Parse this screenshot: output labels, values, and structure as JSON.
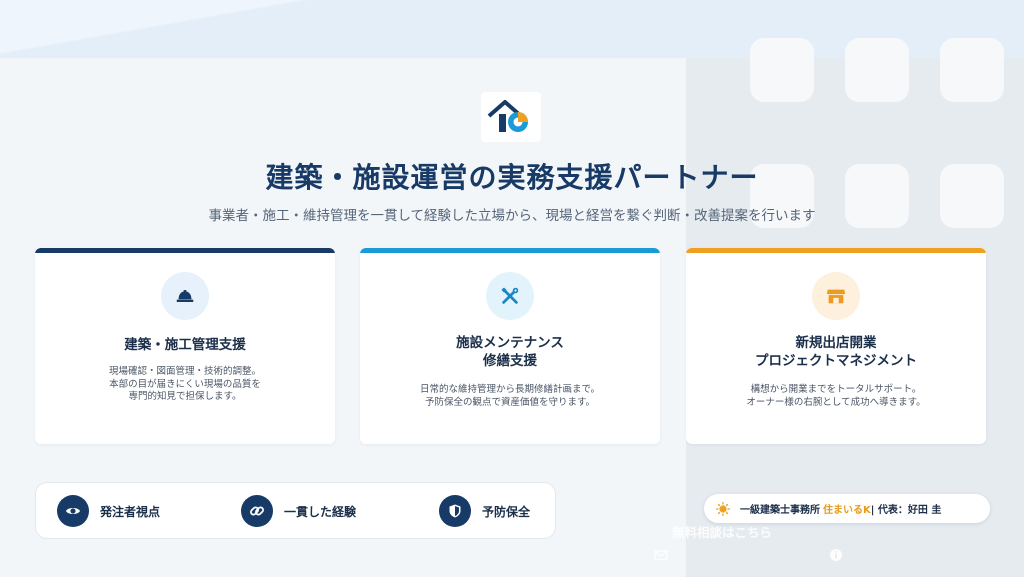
{
  "hero": {
    "title": "建築・施設運営の実務支援パートナー",
    "subtitle": "事業者・施工・維持管理を一貫して経験した立場から、現場と経営を繋ぐ判断・改善提案を行います"
  },
  "cards": [
    {
      "icon": "hard-hat-icon",
      "accent": "#173a66",
      "icon_bg": "#e6f1fb",
      "icon_color": "#173a66",
      "title_lines": [
        "建築・施工管理支援"
      ],
      "desc_lines": [
        "現場確認・図面管理・技術的調整。",
        "本部の目が届きにくい現場の品質を",
        "専門的知見で担保します。"
      ]
    },
    {
      "icon": "tools-icon",
      "accent": "#1a9ad6",
      "icon_bg": "#e3f3fb",
      "icon_color": "#1a86c3",
      "title_lines": [
        "施設メンテナンス",
        "修繕支援"
      ],
      "desc_lines": [
        "日常的な維持管理から長期修繕計画まで。",
        "予防保全の観点で資産価値を守ります。"
      ]
    },
    {
      "icon": "storefront-icon",
      "accent": "#f0a020",
      "icon_bg": "#fdf0dc",
      "icon_color": "#ec9a20",
      "title_lines": [
        "新規出店開業",
        "プロジェクトマネジメント"
      ],
      "desc_lines": [
        "構想から開業までをトータルサポート。",
        "オーナー様の右腕として成功へ導きます。"
      ]
    }
  ],
  "features": [
    {
      "icon": "eye-icon",
      "label": "発注者視点"
    },
    {
      "icon": "link-icon",
      "label": "一貫した経験"
    },
    {
      "icon": "shield-icon",
      "label": "予防保全"
    }
  ],
  "badge": {
    "prefix": "一級建築士事務所",
    "brand": "住まいるK",
    "suffix": "| 代表：好田 圭",
    "icon": "sun-icon"
  },
  "overlay": {
    "consult_text": "無料相談はこちら"
  },
  "colors": {
    "navy": "#173a66",
    "blue": "#1a9ad6",
    "orange": "#f0a020"
  }
}
